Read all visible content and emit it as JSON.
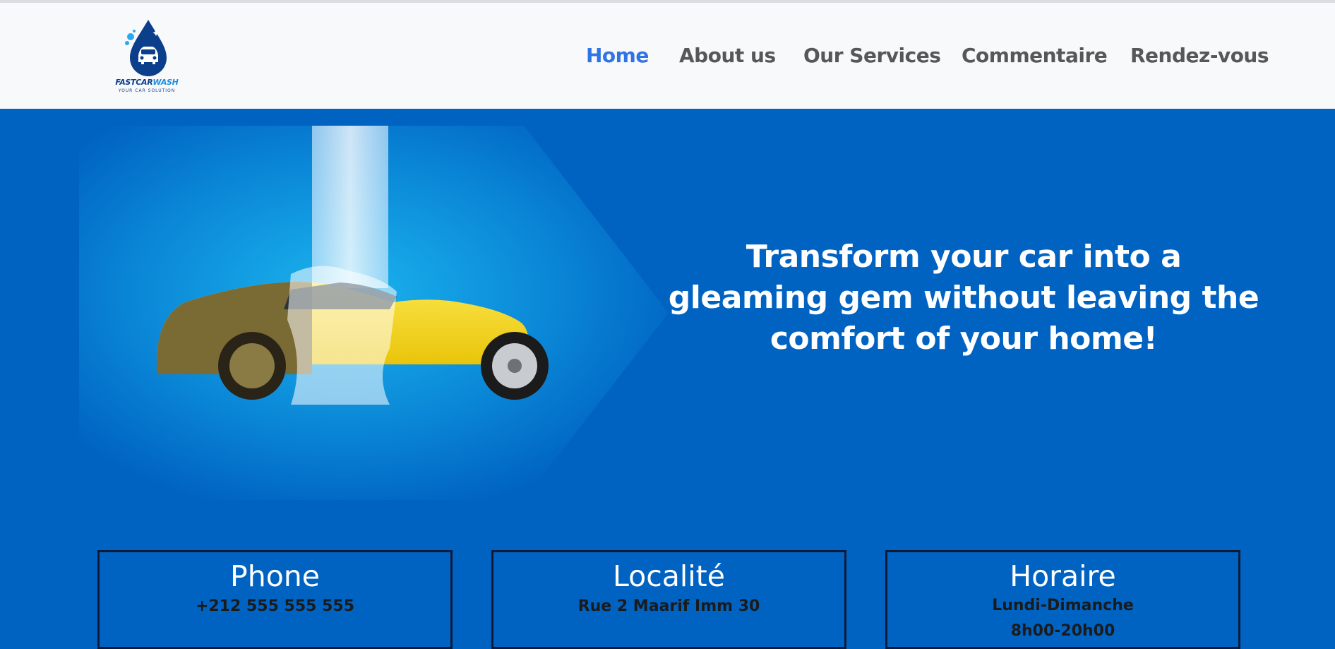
{
  "brand": {
    "name_part1": "FASTCAR",
    "name_part2": "WASH",
    "tagline": "YOUR CAR SOLUTION"
  },
  "nav": {
    "items": [
      {
        "label": "Home",
        "active": true
      },
      {
        "label": "About us",
        "active": false
      },
      {
        "label": "Our Services",
        "active": false
      },
      {
        "label": "Commentaire",
        "active": false
      },
      {
        "label": "Rendez-vous",
        "active": false
      }
    ]
  },
  "hero": {
    "headline": "Transform your car into a gleaming gem without leaving the comfort of your home!"
  },
  "info_cards": [
    {
      "title": "Phone",
      "lines": [
        "+212 555 555 555"
      ]
    },
    {
      "title": "Localité",
      "lines": [
        "Rue 2 Maarif Imm 30"
      ]
    },
    {
      "title": "Horaire",
      "lines": [
        "Lundi-Dimanche",
        "8h00-20h00"
      ]
    }
  ],
  "colors": {
    "page_background": "#0063c2",
    "navbar_background": "#f8f9fa",
    "nav_text": "#575757",
    "nav_active": "#2f73e6",
    "card_border": "#0a1b3a"
  }
}
